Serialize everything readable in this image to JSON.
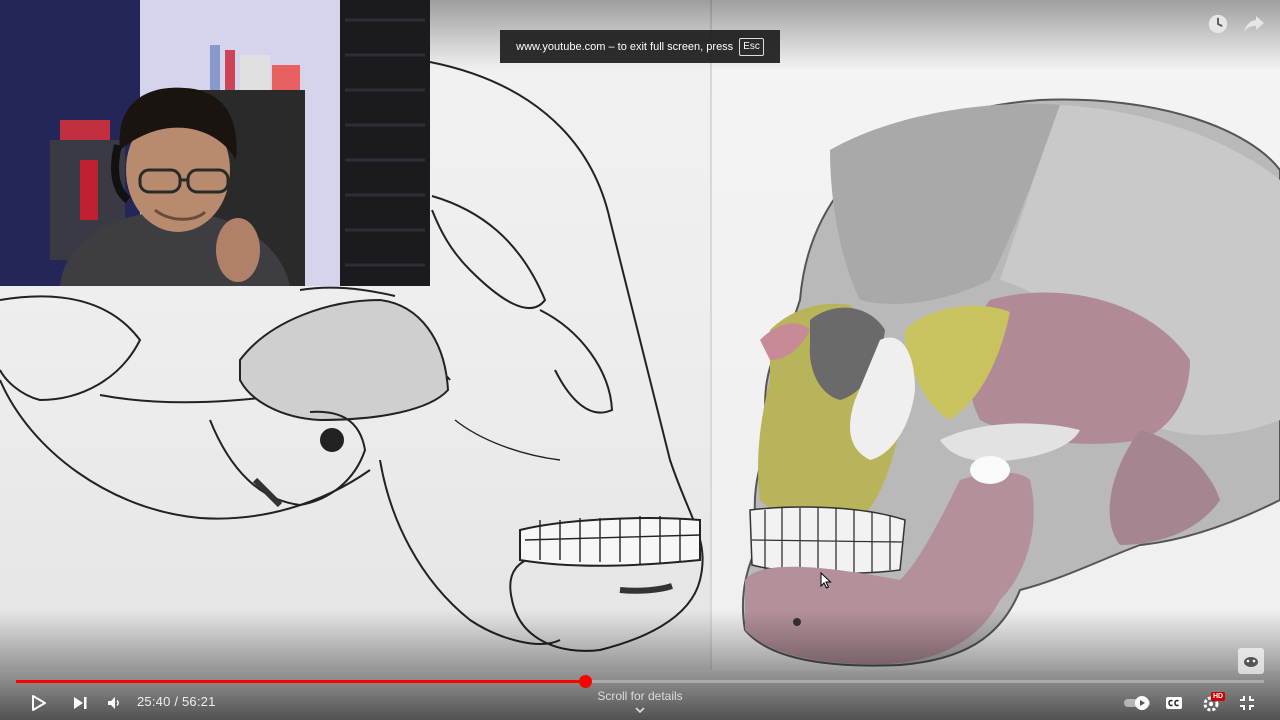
{
  "toast": {
    "text": "www.youtube.com – to exit full screen, press",
    "key": "Esc"
  },
  "player": {
    "current_time": "25:40",
    "duration": "56:21",
    "time_separator": " / ",
    "progress_fraction": 0.4556,
    "scroll_hint": "Scroll for details"
  },
  "icons": {
    "watch_later": "clock-icon",
    "share": "share-arrow-icon",
    "play": "play-icon",
    "next": "next-track-icon",
    "volume": "volume-icon",
    "autoplay": "autoplay-toggle-icon",
    "captions": "cc-icon",
    "settings": "gear-icon",
    "quality_badge": "HD",
    "fullscreen_exit": "exit-fullscreen-icon",
    "channel_logo": "channel-watermark-icon"
  },
  "colors": {
    "accent": "#ff0000",
    "quality_badge": "#cc0000"
  }
}
